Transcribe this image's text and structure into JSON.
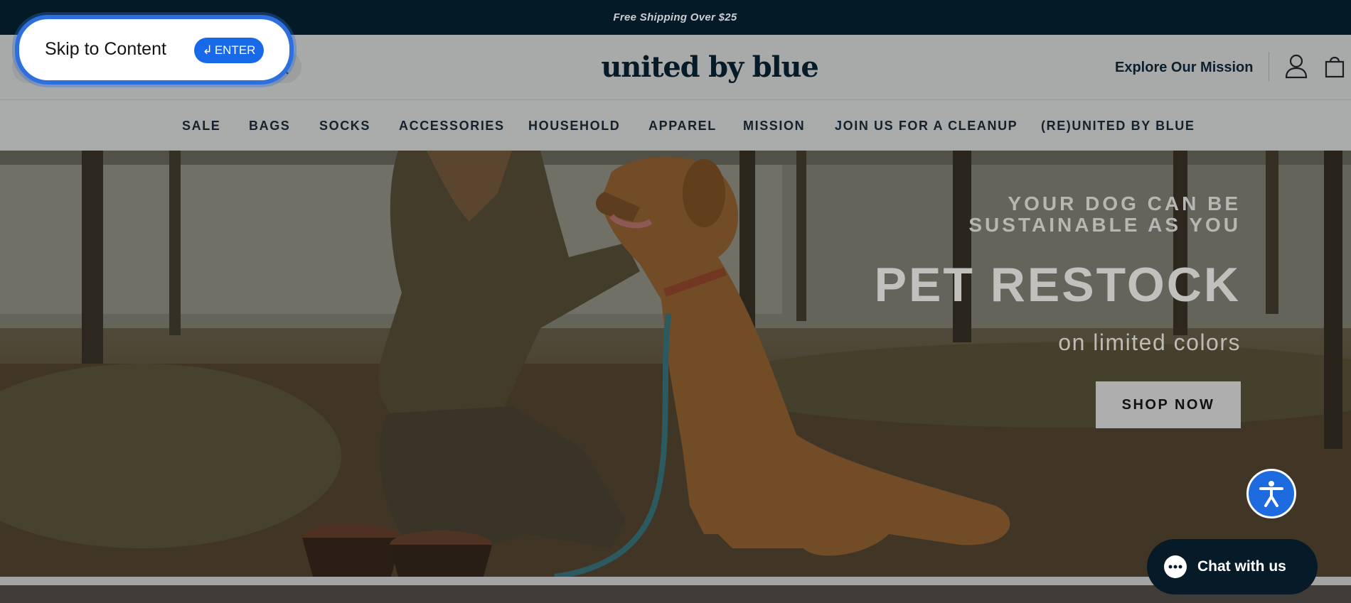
{
  "announcement": {
    "text": "Free Shipping Over $25"
  },
  "skip_link": {
    "label": "Skip to Content",
    "enter_label": "ENTER",
    "enter_glyph": "↲"
  },
  "header": {
    "logo_text": "united by blue",
    "mission_link": "Explore Our Mission",
    "icons": [
      "search-icon",
      "account-icon",
      "cart-icon"
    ]
  },
  "nav": {
    "items": [
      "SALE",
      "BAGS",
      "SOCKS",
      "ACCESSORIES",
      "HOUSEHOLD",
      "APPAREL",
      "MISSION",
      "JOIN US FOR A CLEANUP",
      "(RE)UNITED BY BLUE"
    ]
  },
  "hero": {
    "eyebrow_line1": "YOUR DOG CAN BE",
    "eyebrow_line2": "SUSTAINABLE AS YOU",
    "title": "PET RESTOCK",
    "subtitle": "on limited colors",
    "cta": "SHOP NOW"
  },
  "widgets": {
    "chat_label": "Chat with us",
    "accessibility_icon": "accessibility-icon"
  },
  "colors": {
    "announcement_bg": "#041a26",
    "accent_blue": "#1769e8",
    "chat_bg": "#071a28"
  }
}
